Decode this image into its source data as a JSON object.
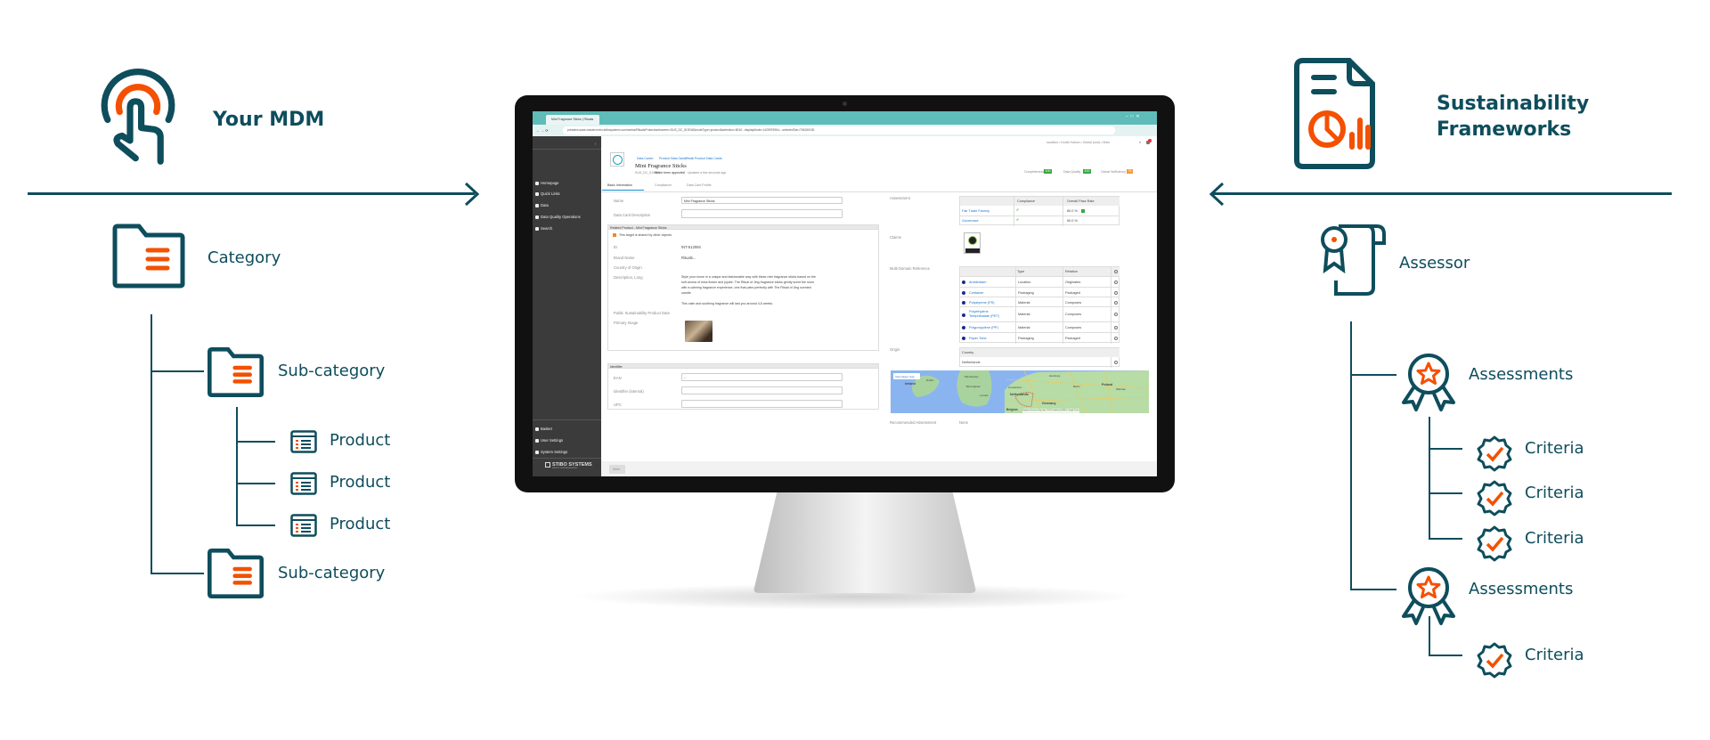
{
  "colors": {
    "primary": "#0e4d5c",
    "accent": "#f45000",
    "browser": "#5fbcb8",
    "sidebar": "#3b3b3b"
  },
  "left": {
    "title": "Your MDM",
    "category": "Category",
    "subcategories": [
      "Sub-category",
      "Sub-category"
    ],
    "products": [
      "Product",
      "Product",
      "Product"
    ]
  },
  "right": {
    "title_line1": "Sustainability",
    "title_line2": "Frameworks",
    "assessor": "Assessor",
    "assessments": [
      "Assessments",
      "Assessments"
    ],
    "criteria": [
      "Criteria",
      "Criteria",
      "Criteria",
      "Criteria"
    ]
  },
  "screen": {
    "tab_title": "Mini Fragrance Sticks | Rituals",
    "url": "presales-saas-master.mdm.stibosystems.com/webui/RitualsProtection#screen=SUS_DC_519018&nodeType=product&selection=8010...displayMode=1425975964;...selectedTab=794260150",
    "user_line": "sandbox • Dodie Hutson • Global (root) • Main",
    "sidebar": {
      "items": [
        "Homepage",
        "Quick Links",
        "Data",
        "Data Quality Operations",
        "Search"
      ],
      "bottom": [
        "Basket",
        "User Settings",
        "System Settings"
      ],
      "logo": "STIBO SYSTEMS",
      "logo_sub": "MASTER DATA MANAGEMENT"
    },
    "breadcrumb": [
      "Data Cards",
      "Product Data Cards",
      "Retail Product Data Cards"
    ],
    "title": "Mini Fragrance Sticks",
    "subtitle_id": "SUS_DC_519018",
    "subtitle_status": "Never been approved",
    "subtitle_meta": "0.1 · Updated a few seconds ago",
    "scores": [
      {
        "label": "Completeness",
        "value": "100",
        "color": "#3aa845"
      },
      {
        "label": "Data Quality",
        "value": "100",
        "color": "#3aa845"
      },
      {
        "label": "Global Sufficiency",
        "value": "75",
        "color": "#f29a3a"
      }
    ],
    "tabs": [
      "Basic Information",
      "Compliance",
      "Data Card Profile"
    ],
    "fields": {
      "name_label": "Name",
      "name_value": "Mini Fragrance Sticks",
      "desc_label": "Data Card Description"
    },
    "related": {
      "header": "Related Product - Mini Fragrance Sticks",
      "warning": "This target is shared by other objects.",
      "rows": [
        {
          "label": "ID",
          "value": "INT-512084"
        },
        {
          "label": "Brand Name",
          "value": "Rituals..."
        },
        {
          "label": "Country of Origin",
          "value": ""
        },
        {
          "label": "Description, Long",
          "value": ""
        },
        {
          "label": "Public Sustainability Product Data",
          "value": ""
        },
        {
          "label": "Primary Image",
          "value": ""
        }
      ],
      "description": [
        "Style your home in a unique and fashionable way with these mini fragrance sticks based on the",
        "soft aroma of lotus flower and jujube. The Ritual of Jing fragrance sticks gently scent the room",
        "with a calming fragrance experience, one that pairs perfectly with The Ritual of Jing scented",
        "candle."
      ],
      "description2": "This calm and soothing fragrance will last you around 4-5 weeks."
    },
    "identifier": {
      "header": "Identifier",
      "rows": [
        {
          "label": "EAN",
          "value": "-"
        },
        {
          "label": "Identifier (internal)",
          "value": ""
        },
        {
          "label": "UPC",
          "value": ""
        }
      ]
    },
    "save": "Save",
    "assessment": {
      "label": "Assessment",
      "headers": [
        "",
        "Compliance",
        "Overall Pass Rate"
      ],
      "rows": [
        {
          "name": "Fair Trade Factory",
          "compliance": "✔",
          "rate": "80.0 %"
        },
        {
          "name": "Governace",
          "compliance": "✔",
          "rate": "50.0 %"
        }
      ]
    },
    "claims": {
      "label": "Claims",
      "logo_text": "FAIR TRADE FACTORY"
    },
    "mdr": {
      "label": "Multi Domain Reference",
      "headers": [
        "",
        "Type",
        "Relation"
      ],
      "rows": [
        {
          "name": "Amsterdam",
          "type": "Location",
          "relation": "Originates"
        },
        {
          "name": "Container",
          "type": "Packaging",
          "relation": "Packaged"
        },
        {
          "name": "Polystyrene (PS)",
          "type": "Material",
          "relation": "Composes"
        },
        {
          "name": "Polyethylene Terephthalate (PET)",
          "type": "Material",
          "relation": "Composes"
        },
        {
          "name": "Polypropylene (PP)",
          "type": "Material",
          "relation": "Composes"
        },
        {
          "name": "Paper Tube",
          "type": "Packaging",
          "relation": "Packaged"
        }
      ]
    },
    "origin": {
      "label": "Origin",
      "header": "Country",
      "value": "Netherlands"
    },
    "map": {
      "button": "View larger map",
      "cities": [
        "Ireland",
        "Dublin",
        "Manchester",
        "Birmingham",
        "London",
        "Amsterdam",
        "Netherlands",
        "Hamburg",
        "Berlin",
        "Germany",
        "Poland",
        "Warsaw",
        "Belgium"
      ],
      "attribution": "Keyboard shortcuts  Map data ©2024 GeoBasis-DE/BKG, Google  Terms"
    },
    "recommended": {
      "label": "Recommended Assessment",
      "value": "None"
    }
  }
}
